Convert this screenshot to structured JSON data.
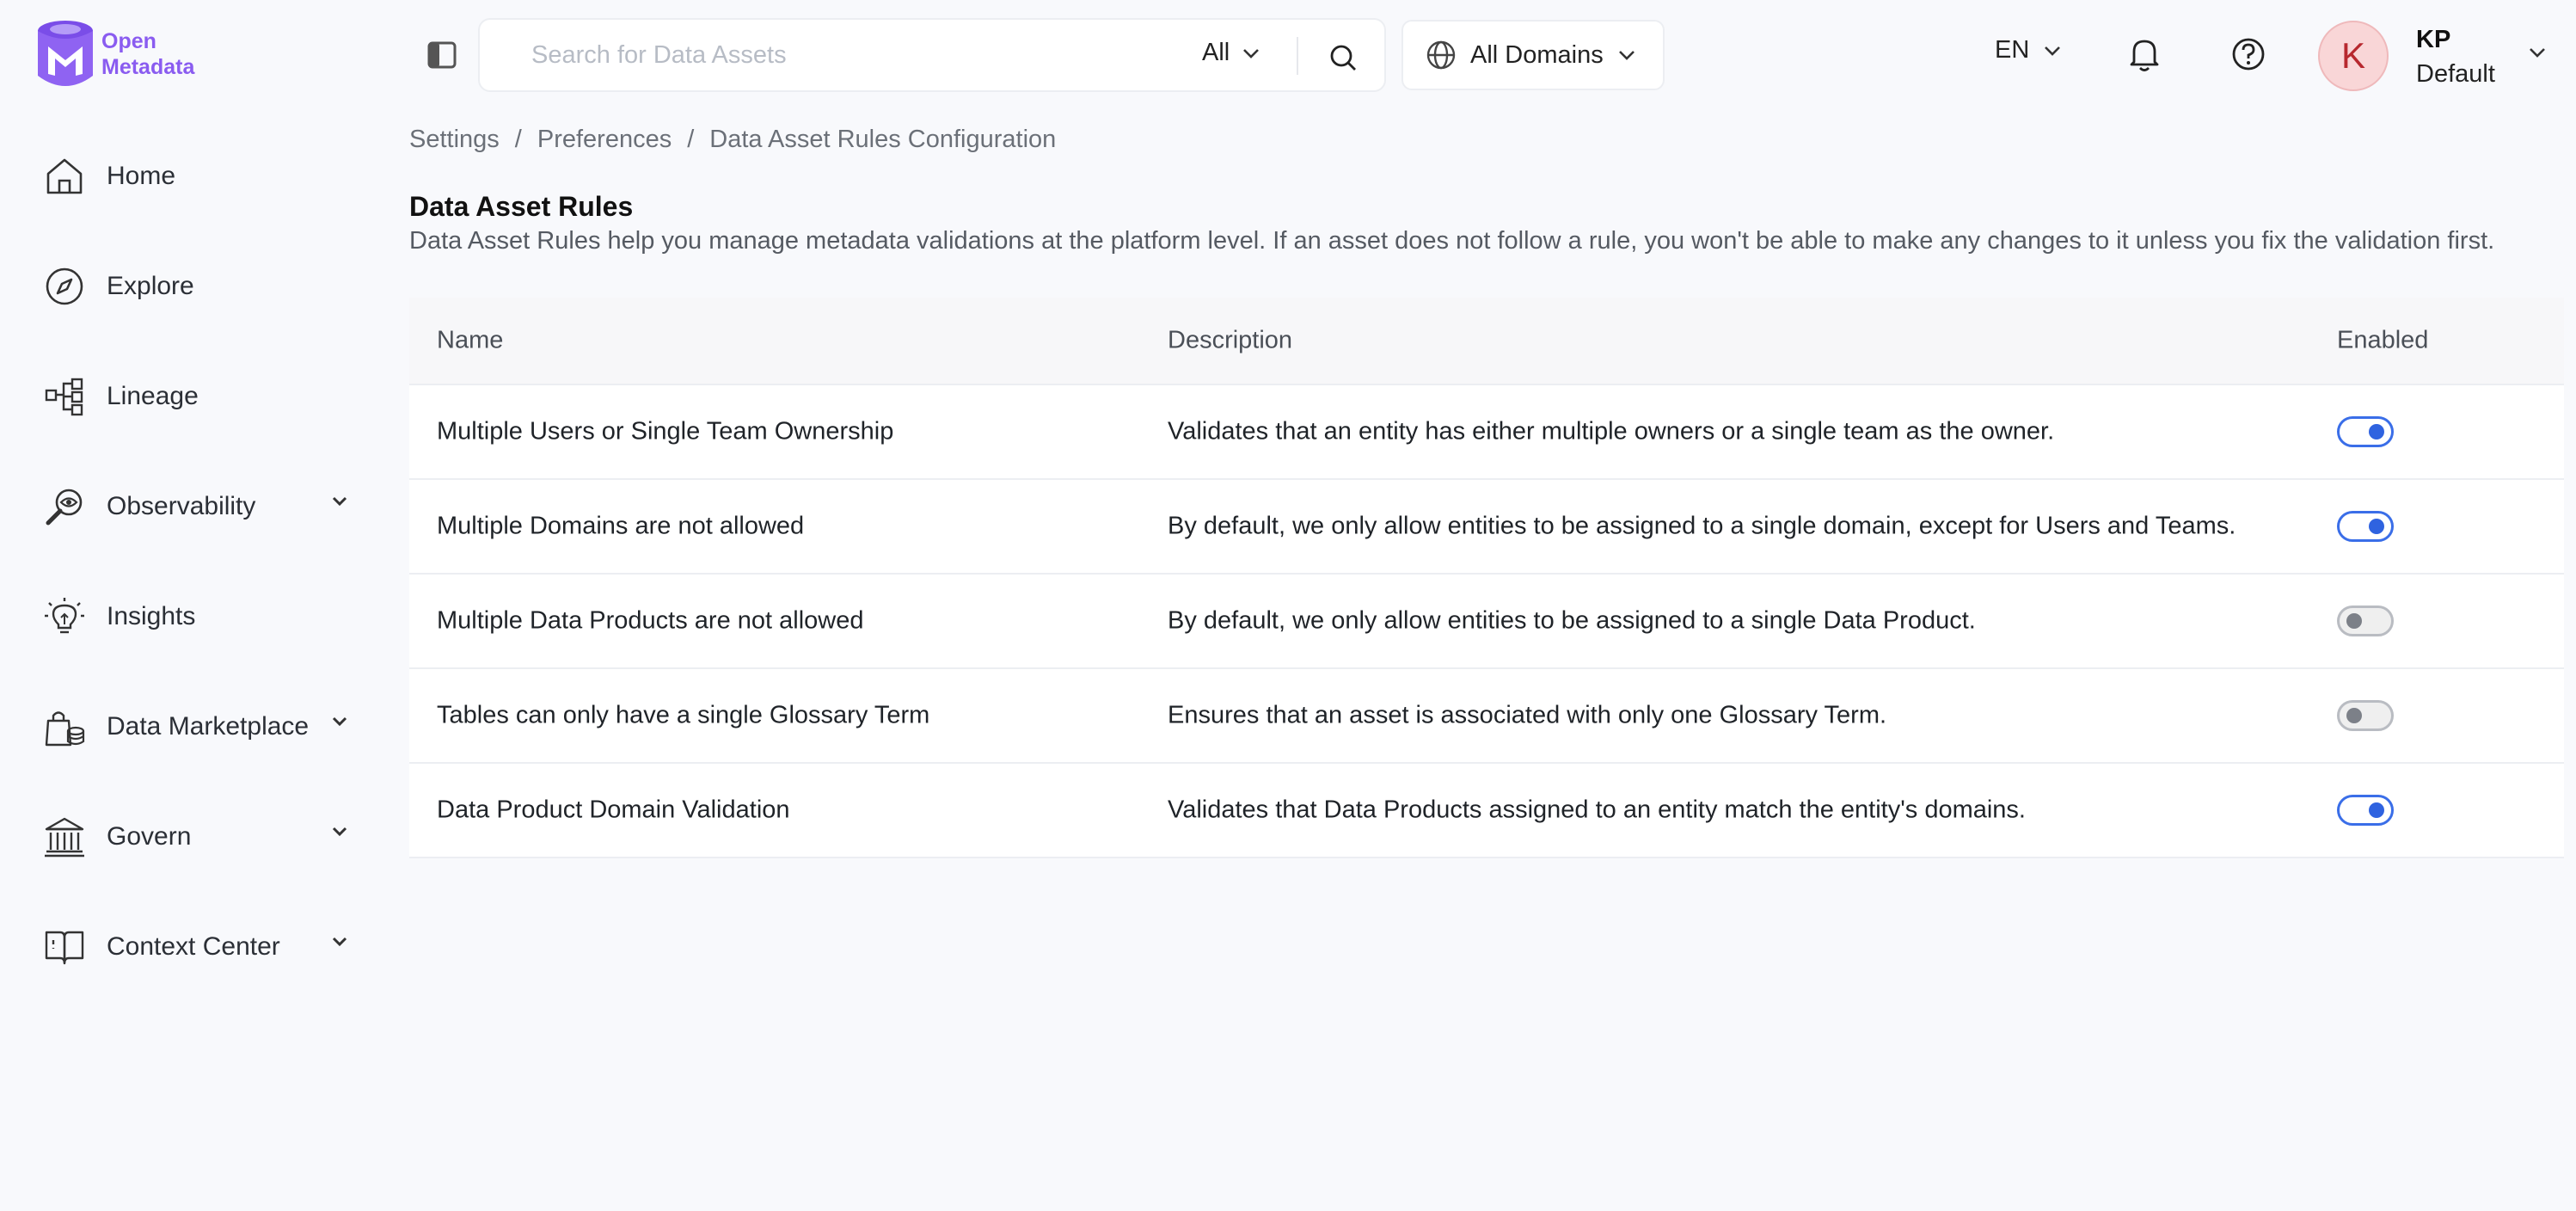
{
  "brand": {
    "line1": "Open",
    "line2": "Metadata",
    "accent": "#8a5cf0"
  },
  "topbar": {
    "sidebar_toggle_icon": "panel-left-icon",
    "search": {
      "placeholder": "Search for Data Assets",
      "value": "",
      "filter": "All"
    },
    "domain": "All Domains",
    "language": "EN",
    "user": {
      "initial": "K",
      "name": "KP",
      "role": "Default"
    }
  },
  "sidebar": {
    "items": [
      {
        "label": "Home",
        "icon": "home-icon",
        "expandable": false
      },
      {
        "label": "Explore",
        "icon": "compass-icon",
        "expandable": false
      },
      {
        "label": "Lineage",
        "icon": "lineage-icon",
        "expandable": false
      },
      {
        "label": "Observability",
        "icon": "observability-icon",
        "expandable": true
      },
      {
        "label": "Insights",
        "icon": "lightbulb-icon",
        "expandable": false
      },
      {
        "label": "Data Marketplace",
        "icon": "marketplace-icon",
        "expandable": true
      },
      {
        "label": "Govern",
        "icon": "bank-icon",
        "expandable": true
      },
      {
        "label": "Context Center",
        "icon": "book-icon",
        "expandable": true
      }
    ]
  },
  "breadcrumb": [
    "Settings",
    "Preferences",
    "Data Asset Rules Configuration"
  ],
  "page": {
    "title": "Data Asset Rules",
    "description": "Data Asset Rules help you manage metadata validations at the platform level. If an asset does not follow a rule, you won't be able to make any changes to it unless you fix the validation first."
  },
  "table": {
    "columns": [
      "Name",
      "Description",
      "Enabled"
    ],
    "rows": [
      {
        "name": "Multiple Users or Single Team Ownership",
        "description": "Validates that an entity has either multiple owners or a single team as the owner.",
        "enabled": true
      },
      {
        "name": "Multiple Domains are not allowed",
        "description": "By default, we only allow entities to be assigned to a single domain, except for Users and Teams.",
        "enabled": true
      },
      {
        "name": "Multiple Data Products are not allowed",
        "description": "By default, we only allow entities to be assigned to a single Data Product.",
        "enabled": false
      },
      {
        "name": "Tables can only have a single Glossary Term",
        "description": "Ensures that an asset is associated with only one Glossary Term.",
        "enabled": false
      },
      {
        "name": "Data Product Domain Validation",
        "description": "Validates that Data Products assigned to an entity match the entity's domains.",
        "enabled": true
      }
    ]
  },
  "colors": {
    "toggle_on": "#2f63e0",
    "toggle_off": "#7c8088",
    "avatar_bg": "#f9d6d7",
    "avatar_text": "#b7282e"
  }
}
